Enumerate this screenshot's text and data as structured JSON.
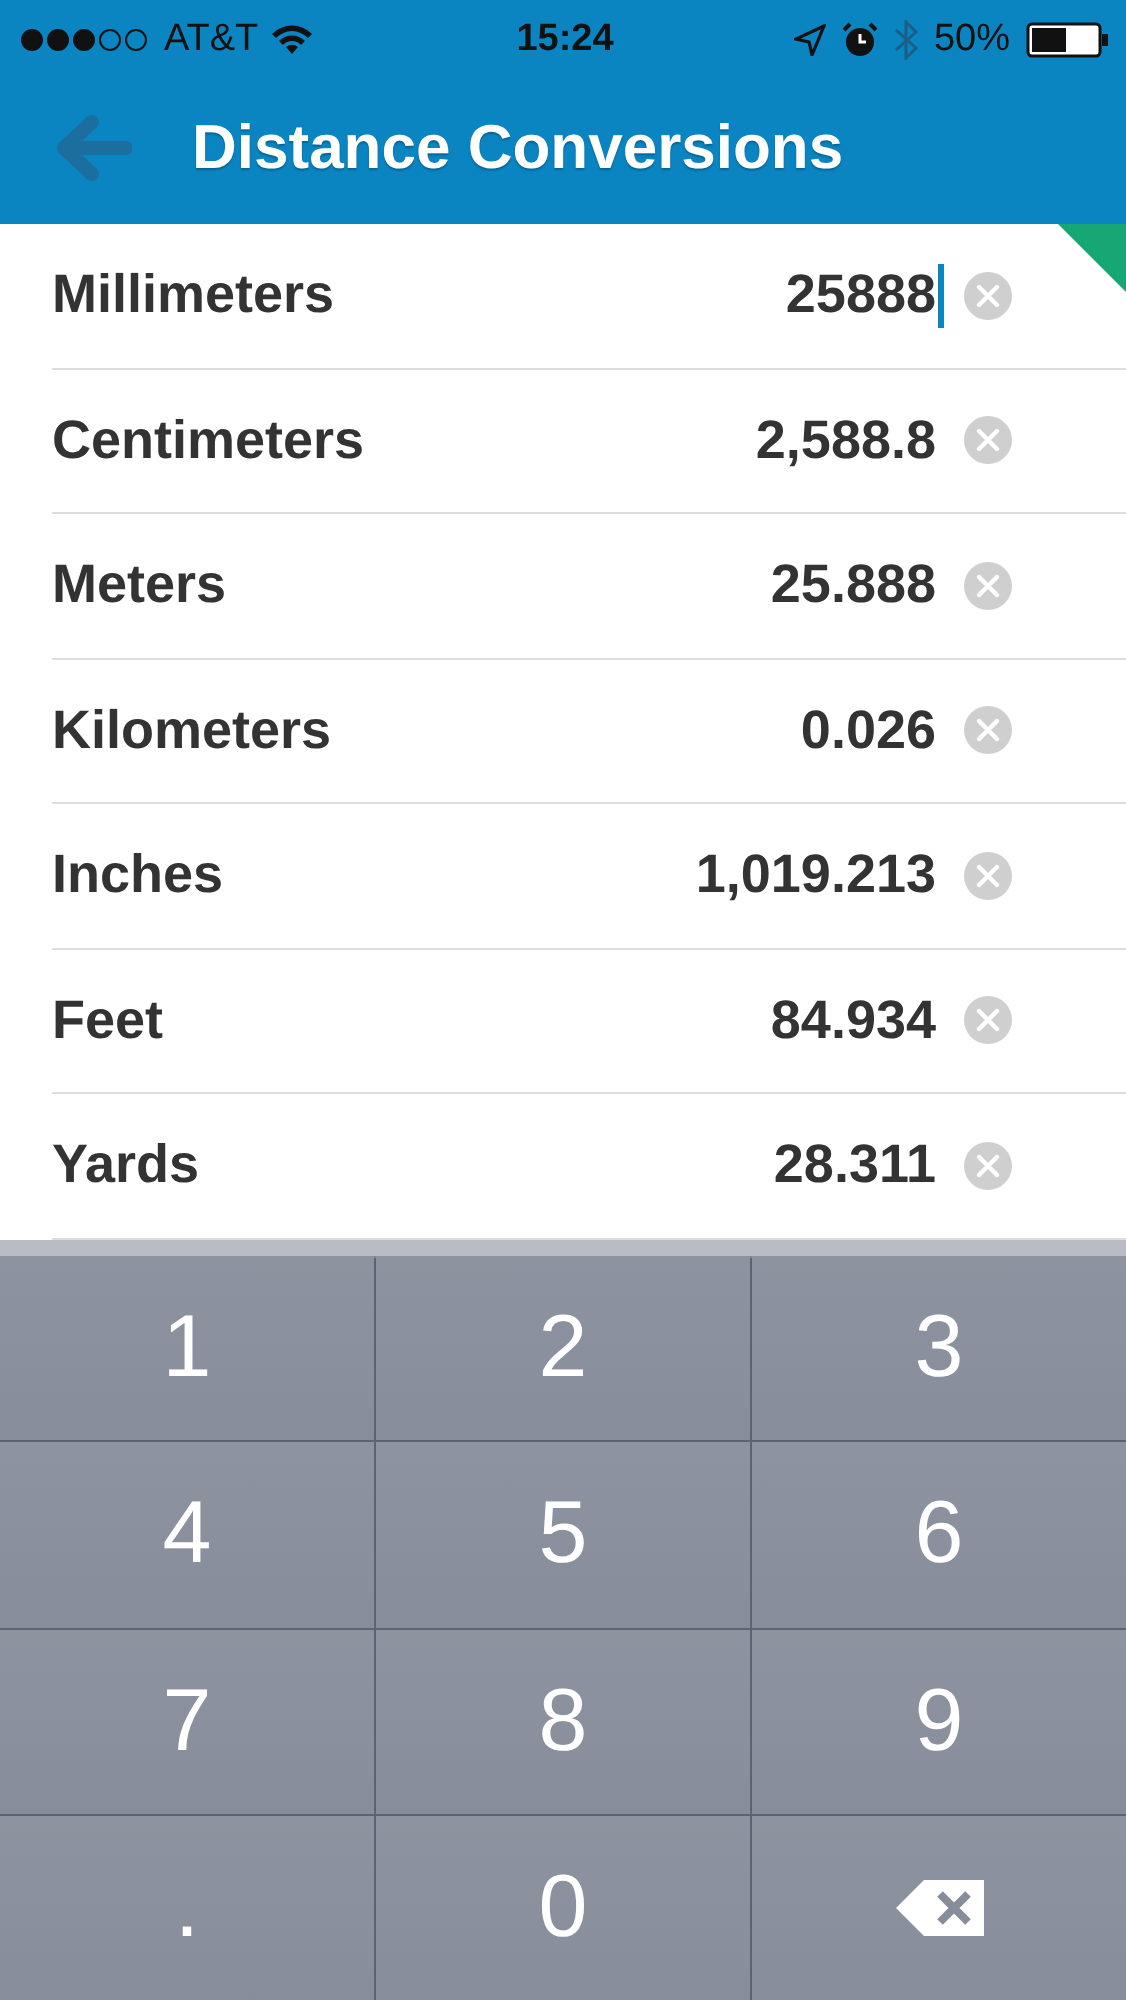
{
  "status_bar": {
    "carrier": "AT&T",
    "time": "15:24",
    "battery": "50%"
  },
  "nav": {
    "title": "Distance Conversions"
  },
  "rows": [
    {
      "unit": "Millimeters",
      "value": "25888",
      "focused": true
    },
    {
      "unit": "Centimeters",
      "value": "2,588.8",
      "focused": false
    },
    {
      "unit": "Meters",
      "value": "25.888",
      "focused": false
    },
    {
      "unit": "Kilometers",
      "value": "0.026",
      "focused": false
    },
    {
      "unit": "Inches",
      "value": "1,019.213",
      "focused": false
    },
    {
      "unit": "Feet",
      "value": "84.934",
      "focused": false
    },
    {
      "unit": "Yards",
      "value": "28.311",
      "focused": false
    }
  ],
  "keypad": [
    {
      "kind": "key",
      "label": "1"
    },
    {
      "kind": "key",
      "label": "2"
    },
    {
      "kind": "key",
      "label": "3"
    },
    {
      "kind": "key",
      "label": "4"
    },
    {
      "kind": "key",
      "label": "5"
    },
    {
      "kind": "key",
      "label": "6"
    },
    {
      "kind": "key",
      "label": "7"
    },
    {
      "kind": "key",
      "label": "8"
    },
    {
      "kind": "key",
      "label": "9"
    },
    {
      "kind": "key",
      "label": "."
    },
    {
      "kind": "key",
      "label": "0"
    },
    {
      "kind": "backspace"
    }
  ]
}
